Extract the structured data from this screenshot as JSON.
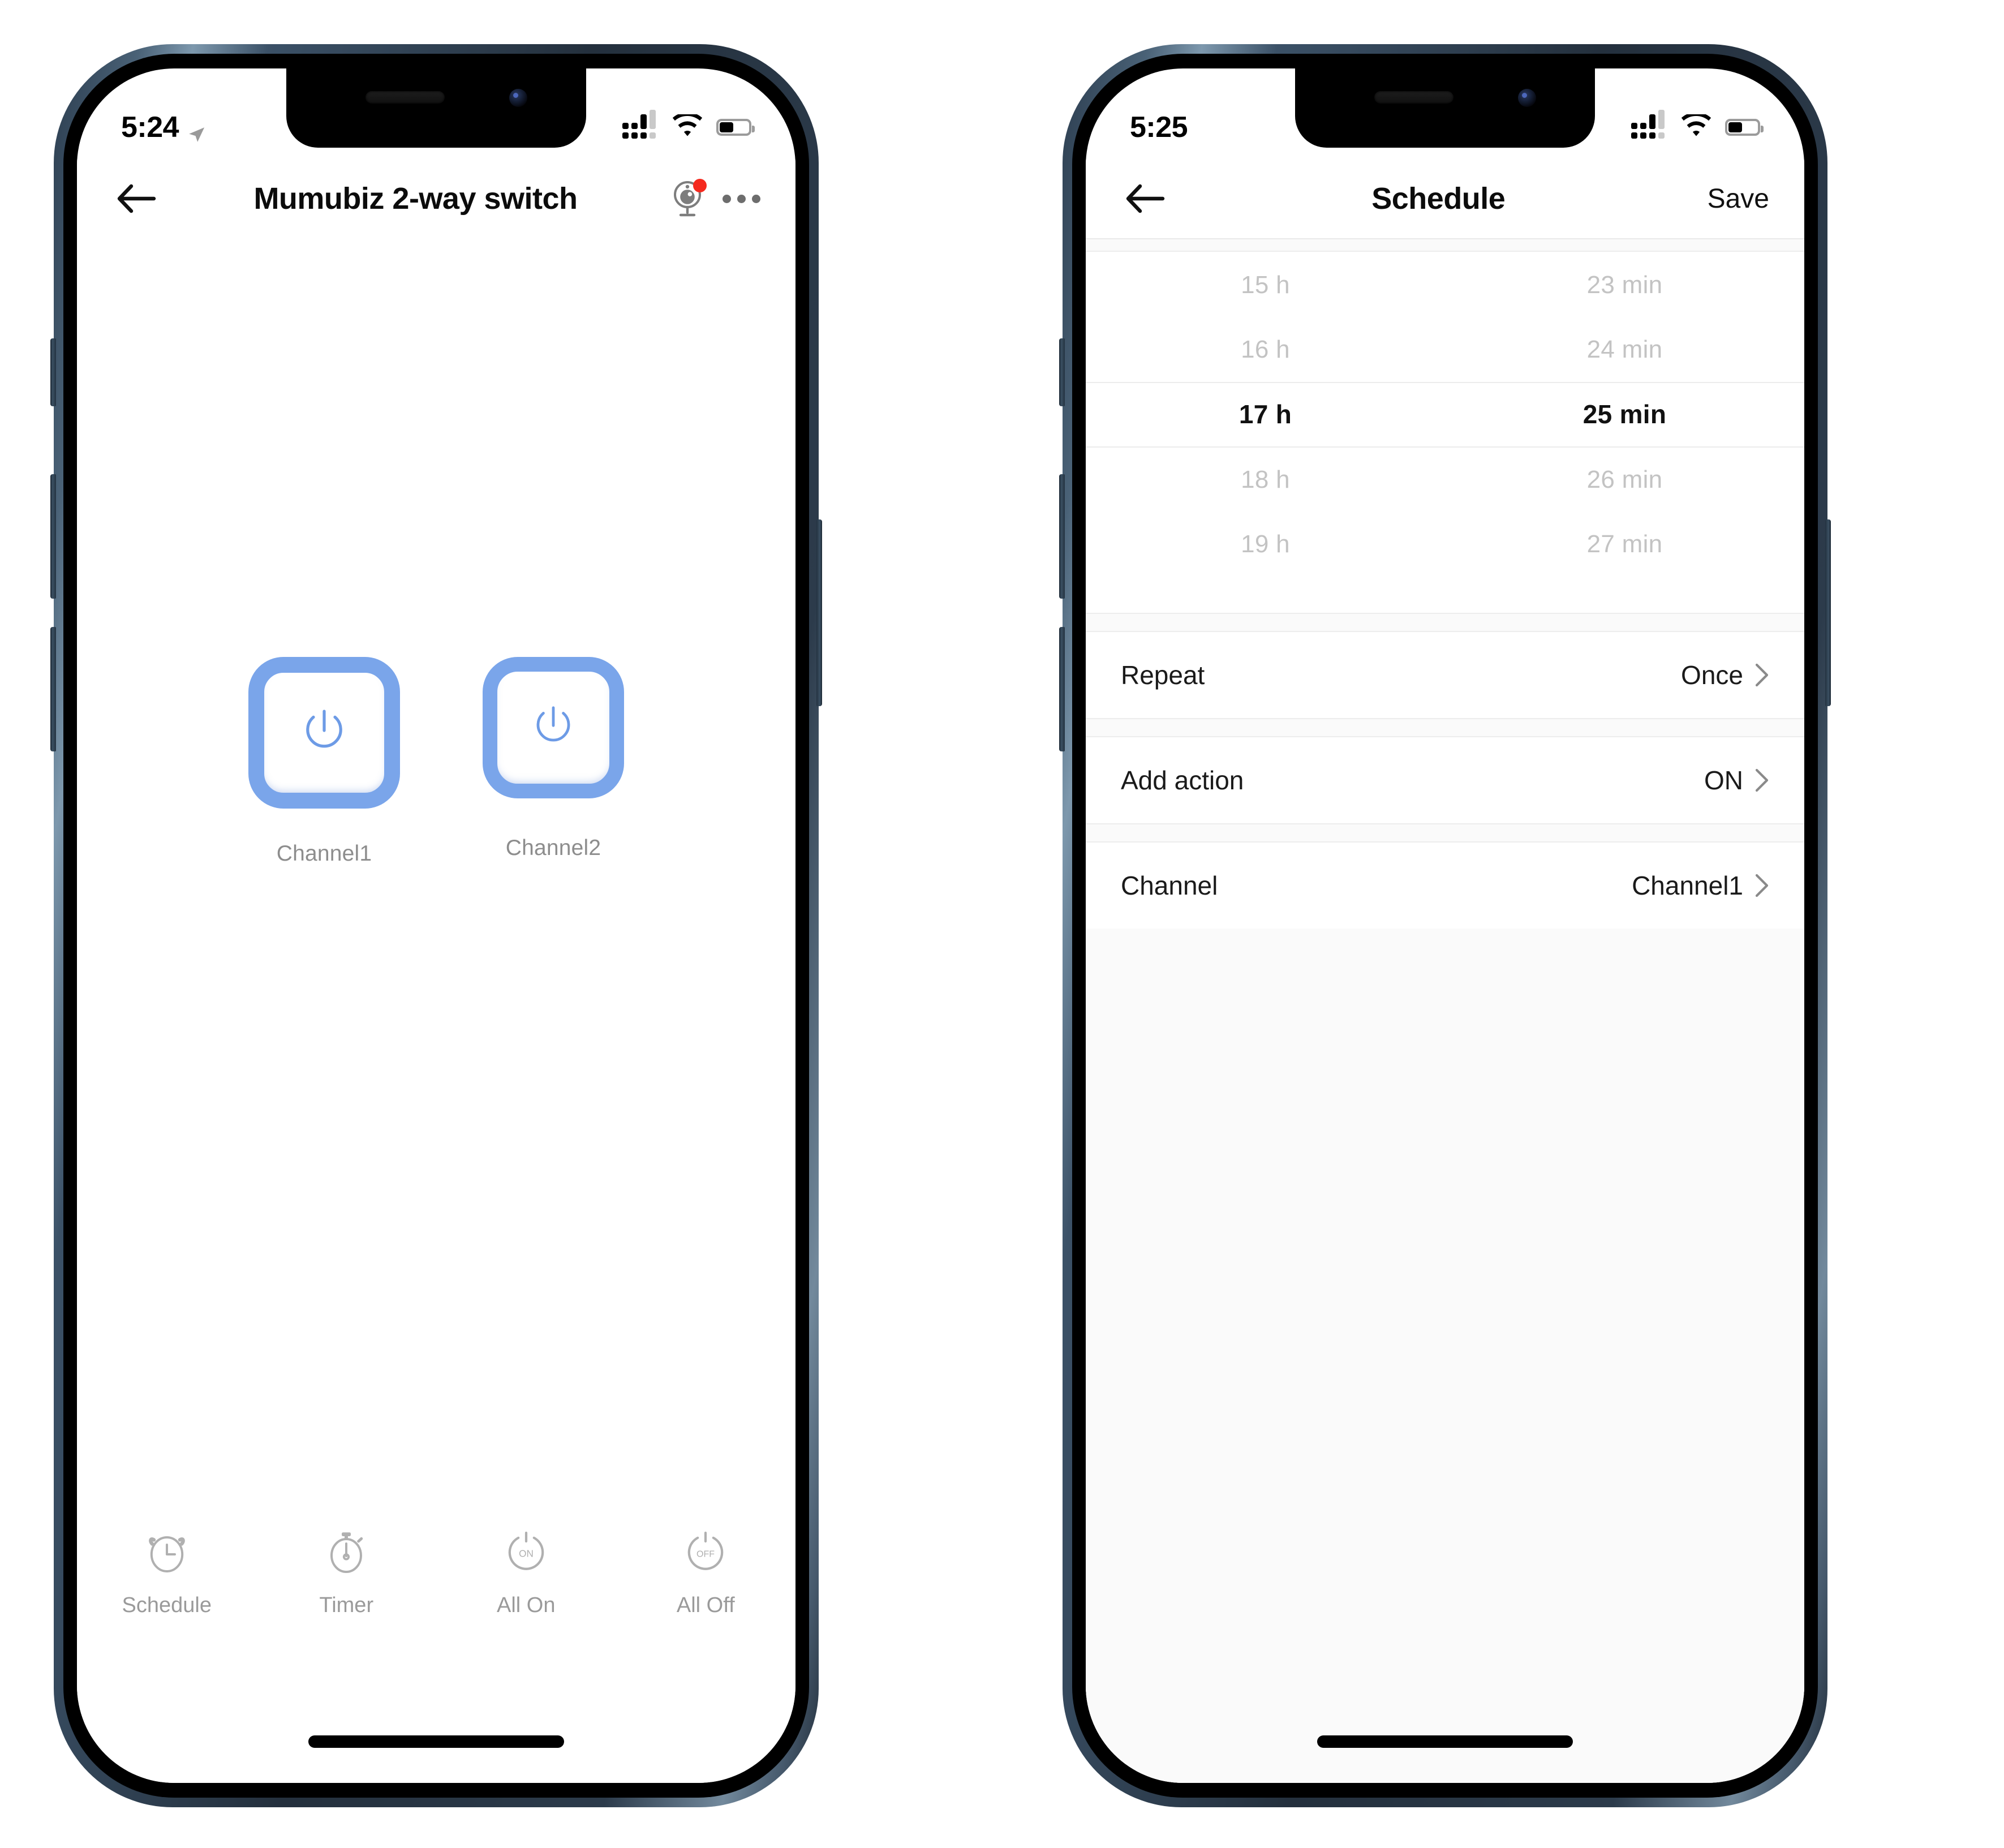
{
  "theme": {
    "accent_blue": "#7aa5ea",
    "power_icon_blue": "#6d9be6",
    "muted_gray": "#9a9a9a",
    "badge_red": "#f5291e",
    "screen_bg": "#ffffff",
    "list_bg": "#fafafa"
  },
  "phone1": {
    "status_bar": {
      "time": "5:24",
      "location_icon": "location-arrow-icon",
      "signal_icon": "cellular-signal-icon",
      "wifi_icon": "wifi-icon",
      "battery_icon": "battery-icon",
      "battery_level_pct": 45
    },
    "nav": {
      "back_icon": "arrow-left-icon",
      "title": "Mumubiz 2-way switch",
      "device_icon": "device-camera-icon",
      "has_notification_badge": true,
      "more_icon": "more-horizontal-icon"
    },
    "channels": [
      {
        "label": "Channel1",
        "power_icon": "power-icon",
        "state": "on"
      },
      {
        "label": "Channel2",
        "power_icon": "power-icon",
        "state": "on"
      }
    ],
    "toolbar": [
      {
        "label": "Schedule",
        "icon": "alarm-clock-icon"
      },
      {
        "label": "Timer",
        "icon": "stopwatch-icon"
      },
      {
        "label": "All On",
        "icon": "power-on-circle-icon",
        "inner_text": "ON"
      },
      {
        "label": "All Off",
        "icon": "power-off-circle-icon",
        "inner_text": "OFF"
      }
    ]
  },
  "phone2": {
    "status_bar": {
      "time": "5:25",
      "signal_icon": "cellular-signal-icon",
      "wifi_icon": "wifi-icon",
      "battery_icon": "battery-icon",
      "battery_level_pct": 45
    },
    "nav": {
      "back_icon": "arrow-left-icon",
      "title": "Schedule",
      "save_label": "Save"
    },
    "time_picker": {
      "hours": [
        {
          "text": "15 h",
          "selected": false
        },
        {
          "text": "16 h",
          "selected": false
        },
        {
          "text": "17 h",
          "selected": true
        },
        {
          "text": "18 h",
          "selected": false
        },
        {
          "text": "19 h",
          "selected": false
        }
      ],
      "minutes": [
        {
          "text": "23 min",
          "selected": false
        },
        {
          "text": "24 min",
          "selected": false
        },
        {
          "text": "25 min",
          "selected": true
        },
        {
          "text": "26 min",
          "selected": false
        },
        {
          "text": "27 min",
          "selected": false
        }
      ],
      "selected_hour": "17 h",
      "selected_minute": "25 min"
    },
    "rows": [
      {
        "label": "Repeat",
        "value": "Once",
        "chevron": "chevron-right-icon"
      },
      {
        "label": "Add action",
        "value": "ON",
        "chevron": "chevron-right-icon"
      },
      {
        "label": "Channel",
        "value": "Channel1",
        "chevron": "chevron-right-icon"
      }
    ]
  }
}
